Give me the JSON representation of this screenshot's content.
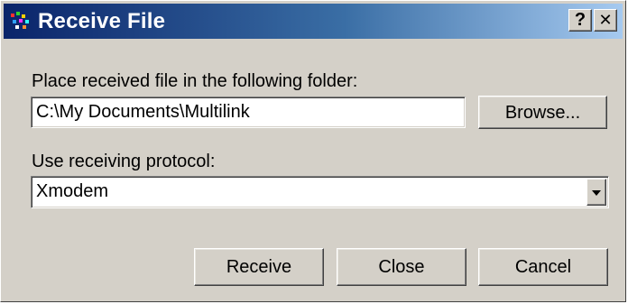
{
  "window": {
    "title": "Receive File",
    "icon": "multilink-app-icon",
    "help_label": "?",
    "close_label": "✕"
  },
  "folder": {
    "label": "Place received file in the following folder:",
    "value": "C:\\My Documents\\Multilink",
    "browse_label": "Browse..."
  },
  "protocol": {
    "label": "Use receiving protocol:",
    "selected": "Xmodem"
  },
  "buttons": {
    "receive": "Receive",
    "close": "Close",
    "cancel": "Cancel"
  },
  "colors": {
    "titlebar_start": "#0a246a",
    "titlebar_end": "#a6caf0",
    "face": "#d4d0c8"
  }
}
